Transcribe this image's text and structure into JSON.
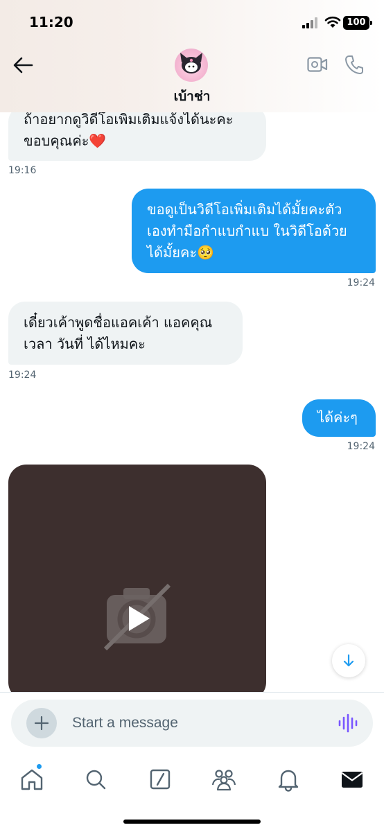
{
  "status_bar": {
    "time": "11:20",
    "battery": "100"
  },
  "header": {
    "contact_name": "เบ้าช่า",
    "icons": [
      "back-arrow-icon",
      "video-call-icon",
      "phone-icon"
    ]
  },
  "messages": [
    {
      "side": "in",
      "lines": [
        "ถ้าอยากดูวิดีโอเพิ่มเติมแจ้งได้นะคะ",
        "ขอบคุณค่ะ❤️"
      ],
      "time": "19:16"
    },
    {
      "side": "out",
      "lines": [
        "ขอดูเป็นวิดีโอเพิ่มเติมได้มั้ยคะตัว",
        "เองทำมือกำแบกำแบ ในวิดีโอด้วย",
        "ได้มั้ยคะ🥺"
      ],
      "time": "19:24"
    },
    {
      "side": "in",
      "lines": [
        "เดี๋ยวเค้าพูดชื่อแอคเค้า แอคคุณ",
        "เวลา วันที่ ได้ไหมคะ"
      ],
      "time": "19:24"
    },
    {
      "side": "out",
      "lines": [
        "ได้ค่ะๆ"
      ],
      "time": "19:24"
    }
  ],
  "video_message": {
    "icon": "play-icon"
  },
  "composer": {
    "placeholder": "Start a message",
    "value": ""
  },
  "nav": {
    "items": [
      "home-icon",
      "search-icon",
      "grok-icon",
      "communities-icon",
      "notifications-icon",
      "messages-icon"
    ]
  },
  "colors": {
    "accent": "#1d9bf0",
    "incoming_bubble": "#eff3f4",
    "video_bg": "#3d2f2e",
    "voice_icon": "#7856ff"
  }
}
